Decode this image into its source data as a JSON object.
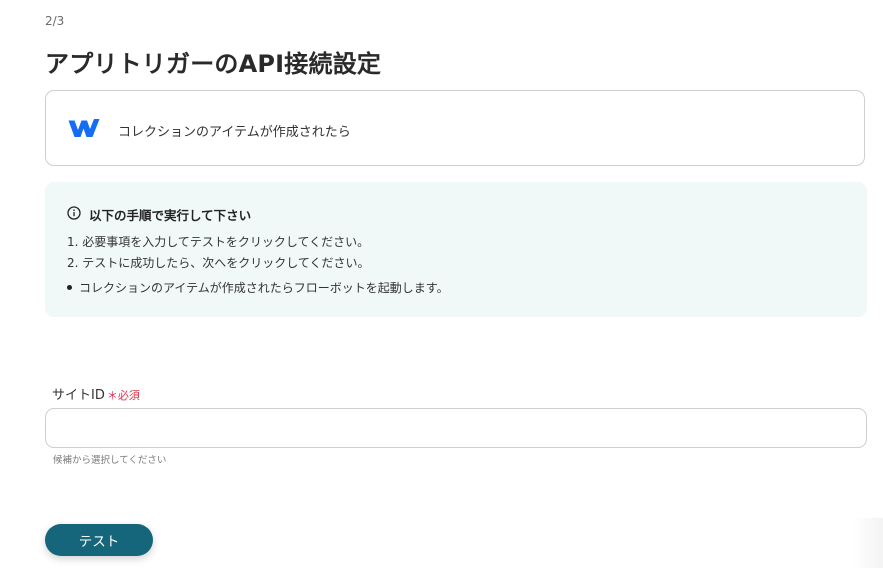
{
  "step_indicator": "2/3",
  "page_title": "アプリトリガーのAPI接続設定",
  "app_card": {
    "icon": "webflow-logo",
    "label": "コレクションのアイテムが作成されたら"
  },
  "info_box": {
    "icon": "info-circle-icon",
    "heading": "以下の手順で実行して下さい",
    "steps": [
      "1. 必要事項を入力してテストをクリックしてください。",
      "2. テストに成功したら、次へをクリックしてください。"
    ],
    "bullet": "コレクションのアイテムが作成されたらフローボットを起動します。"
  },
  "site_id_field": {
    "label": "サイトID",
    "required_label": "＊必須",
    "value": "",
    "hint": "候補から選択してください"
  },
  "test_button": {
    "label": "テスト"
  },
  "colors": {
    "accent": "#15667a",
    "required": "#e0334a",
    "info_bg": "#f1f9f8",
    "webflow_blue": "#146ef5"
  }
}
